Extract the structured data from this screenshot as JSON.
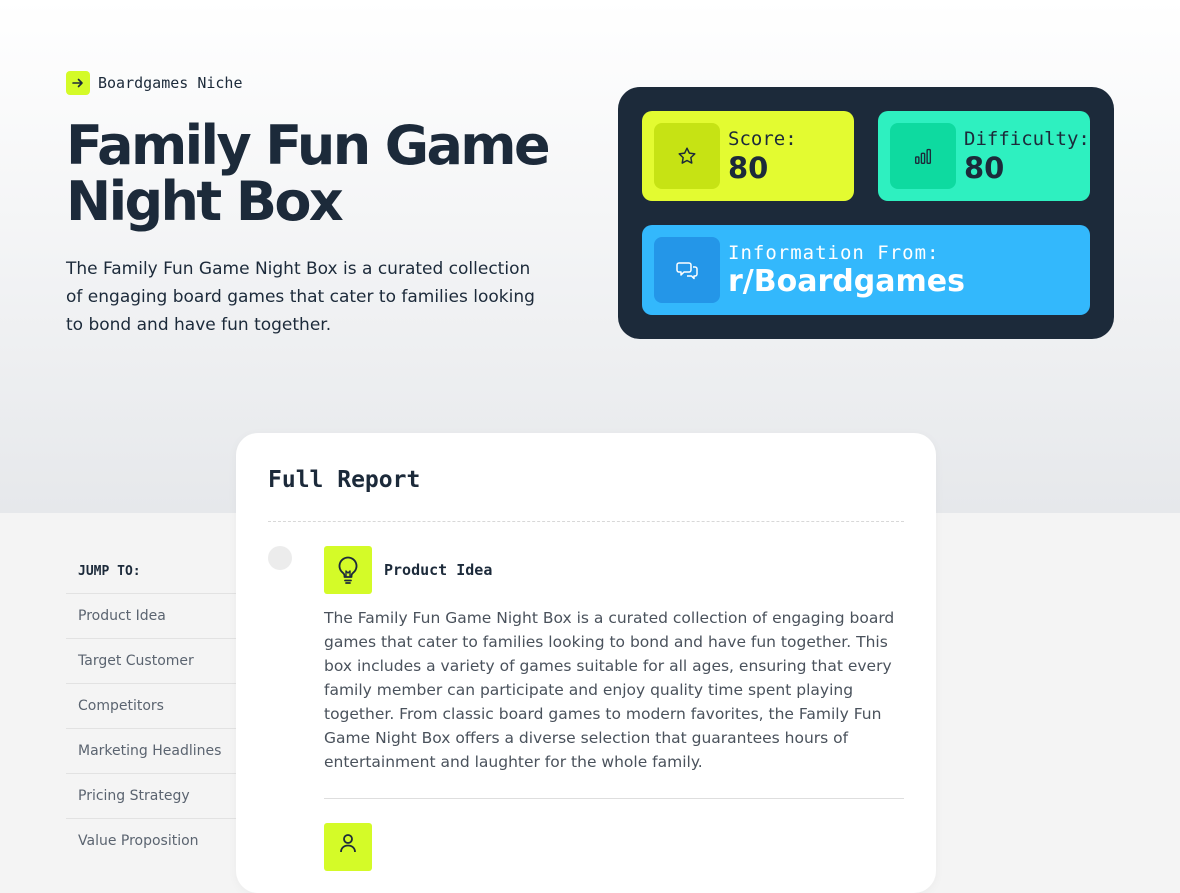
{
  "hero": {
    "niche_label": "Boardgames Niche",
    "title": "Family Fun Game Night Box",
    "description": "The Family Fun Game Night Box is a curated collection of engaging board games that cater to families looking to bond and have fun together."
  },
  "stats": {
    "score": {
      "label": "Score:",
      "value": "80",
      "icon": "star-icon",
      "color": "#e3fb31"
    },
    "difficulty": {
      "label": "Difficulty:",
      "value": "80",
      "icon": "bar-chart-icon",
      "color": "#2ef0c0"
    },
    "source": {
      "label": "Information From:",
      "value": "r/Boardgames",
      "icon": "chat-bubbles-icon",
      "color": "#33b8fc"
    }
  },
  "sidebar": {
    "heading": "JUMP TO:",
    "items": [
      {
        "label": "Product Idea"
      },
      {
        "label": "Target Customer"
      },
      {
        "label": "Competitors"
      },
      {
        "label": "Marketing Headlines"
      },
      {
        "label": "Pricing Strategy"
      },
      {
        "label": "Value Proposition"
      }
    ]
  },
  "report": {
    "title": "Full Report",
    "sections": [
      {
        "title": "Product Idea",
        "icon": "lightbulb-icon",
        "body": "The Family Fun Game Night Box is a curated collection of engaging board games that cater to families looking to bond and have fun together. This box includes a variety of games suitable for all ages, ensuring that every family member can participate and enjoy quality time spent playing together. From classic board games to modern favorites, the Family Fun Game Night Box offers a diverse selection that guarantees hours of entertainment and laughter for the whole family."
      }
    ]
  },
  "colors": {
    "accent": "#d4fb28",
    "dark": "#1c2a3a"
  }
}
